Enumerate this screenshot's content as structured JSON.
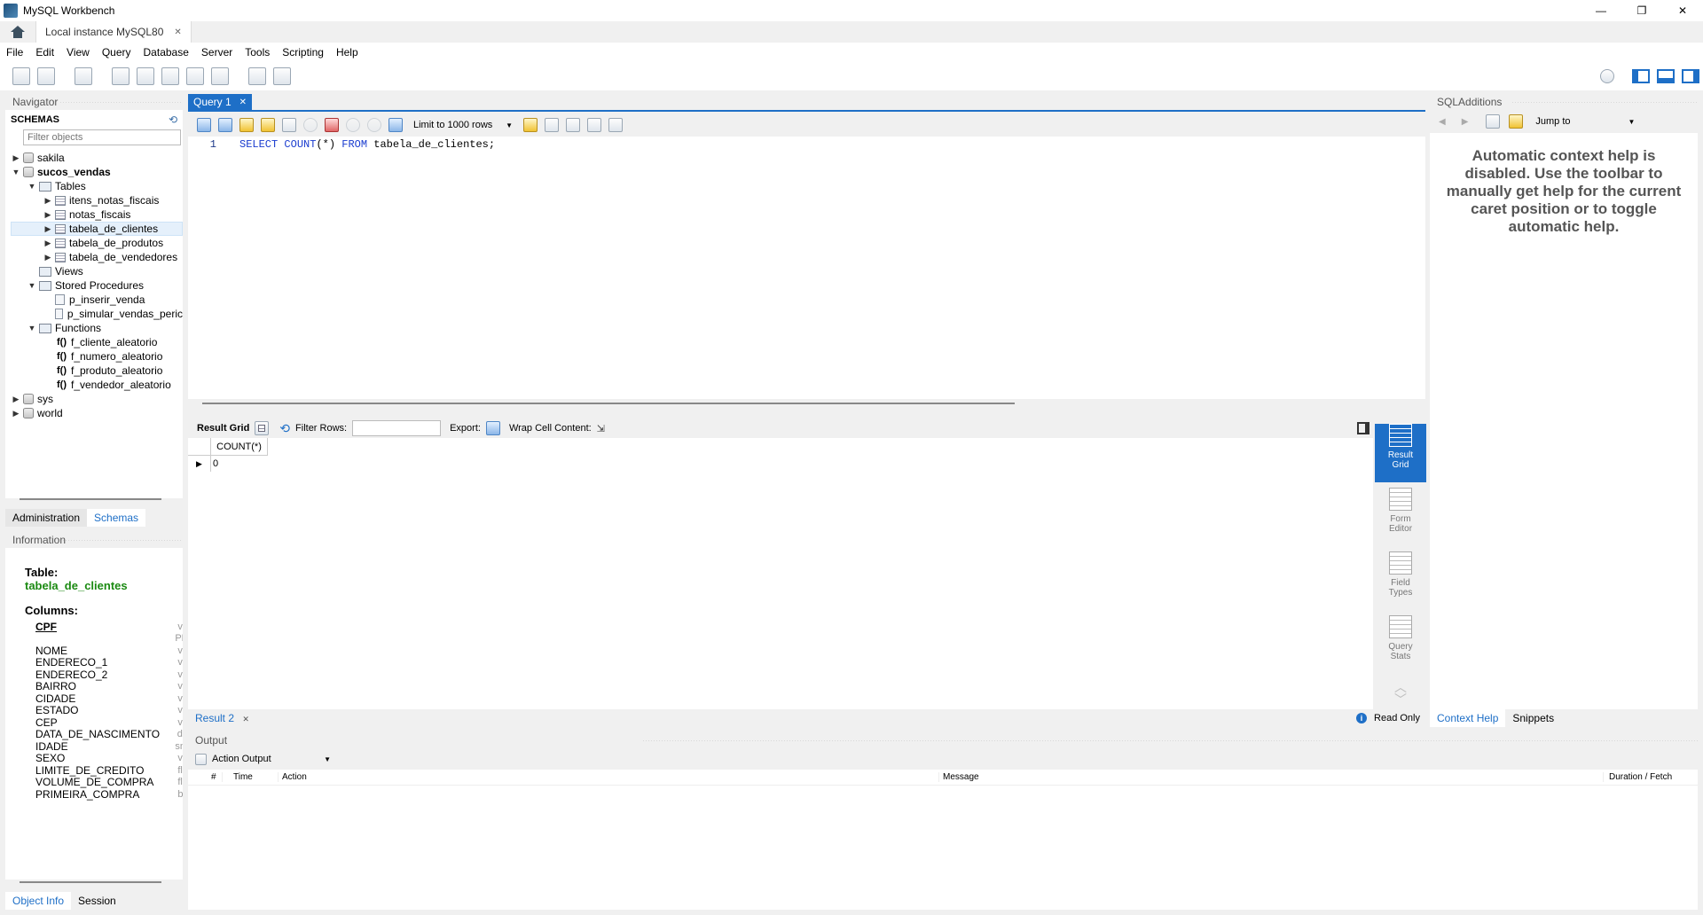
{
  "window": {
    "title": "MySQL Workbench",
    "minimize": "—",
    "restore": "❐",
    "close": "✕"
  },
  "conn_tab": {
    "label": "Local instance MySQL80",
    "close": "✕"
  },
  "menu": [
    "File",
    "Edit",
    "View",
    "Query",
    "Database",
    "Server",
    "Tools",
    "Scripting",
    "Help"
  ],
  "navigator": {
    "title": "Navigator",
    "schemas_title": "SCHEMAS",
    "filter_placeholder": "Filter objects"
  },
  "tree": {
    "sakila": "sakila",
    "sucos_vendas": "sucos_vendas",
    "tables": "Tables",
    "table_items": [
      "itens_notas_fiscais",
      "notas_fiscais",
      "tabela_de_clientes",
      "tabela_de_produtos",
      "tabela_de_vendedores"
    ],
    "views": "Views",
    "procs": "Stored Procedures",
    "proc_items": [
      "p_inserir_venda",
      "p_simular_vendas_peric"
    ],
    "functions": "Functions",
    "func_prefix": "f()",
    "func_items": [
      "f_cliente_aleatorio",
      "f_numero_aleatorio",
      "f_produto_aleatorio",
      "f_vendedor_aleatorio"
    ],
    "sys": "sys",
    "world": "world"
  },
  "nav_tabs": {
    "admin": "Administration",
    "schemas": "Schemas"
  },
  "info": {
    "title": "Information",
    "table_label": "Table:",
    "table_name": "tabela_de_clientes",
    "columns_label": "Columns:",
    "columns": [
      {
        "name": "CPF",
        "type": "va"
      },
      {
        "name": "",
        "type": "PK"
      },
      {
        "name": "NOME",
        "type": "va"
      },
      {
        "name": "ENDERECO_1",
        "type": "va"
      },
      {
        "name": "ENDERECO_2",
        "type": "va"
      },
      {
        "name": "BAIRRO",
        "type": "va"
      },
      {
        "name": "CIDADE",
        "type": "va"
      },
      {
        "name": "ESTADO",
        "type": "va"
      },
      {
        "name": "CEP",
        "type": "va"
      },
      {
        "name": "DATA_DE_NASCIMENTO",
        "type": "da"
      },
      {
        "name": "IDADE",
        "type": "sm"
      },
      {
        "name": "SEXO",
        "type": "va"
      },
      {
        "name": "LIMITE_DE_CREDITO",
        "type": "flo"
      },
      {
        "name": "VOLUME_DE_COMPRA",
        "type": "flo"
      },
      {
        "name": "PRIMEIRA_COMPRA",
        "type": "bit"
      }
    ]
  },
  "bottom_tabs": {
    "object_info": "Object Info",
    "session": "Session"
  },
  "query_tab": {
    "label": "Query 1",
    "close": "✕"
  },
  "editor": {
    "limit": "Limit to 1000 rows",
    "line": "1",
    "kw1": "SELECT",
    "fn": "COUNT",
    "args": "(*)",
    "kw2": "FROM",
    "rest": "tabela_de_clientes;"
  },
  "result": {
    "grid_label": "Result Grid",
    "filter_label": "Filter Rows:",
    "export_label": "Export:",
    "wrap_label": "Wrap Cell Content:",
    "column": "COUNT(*)",
    "value": "0",
    "tab2": "Result 2",
    "tab2_close": "✕",
    "read_only": "Read Only"
  },
  "side_tabs": [
    {
      "line1": "Result",
      "line2": "Grid"
    },
    {
      "line1": "Form",
      "line2": "Editor"
    },
    {
      "line1": "Field",
      "line2": "Types"
    },
    {
      "line1": "Query",
      "line2": "Stats"
    }
  ],
  "sql_additions": {
    "title": "SQLAdditions",
    "jump": "Jump to",
    "help_text": "Automatic context help is disabled. Use the toolbar to manually get help for the current caret position or to toggle automatic help.",
    "tab_context": "Context Help",
    "tab_snippets": "Snippets"
  },
  "output": {
    "title": "Output",
    "selector": "Action Output",
    "headers": [
      "#",
      "Time",
      "Action",
      "Message",
      "Duration / Fetch"
    ]
  },
  "colors": {
    "accent": "#1e6fc7",
    "keyword": "#1a3ccf",
    "green": "#1b8a12"
  }
}
